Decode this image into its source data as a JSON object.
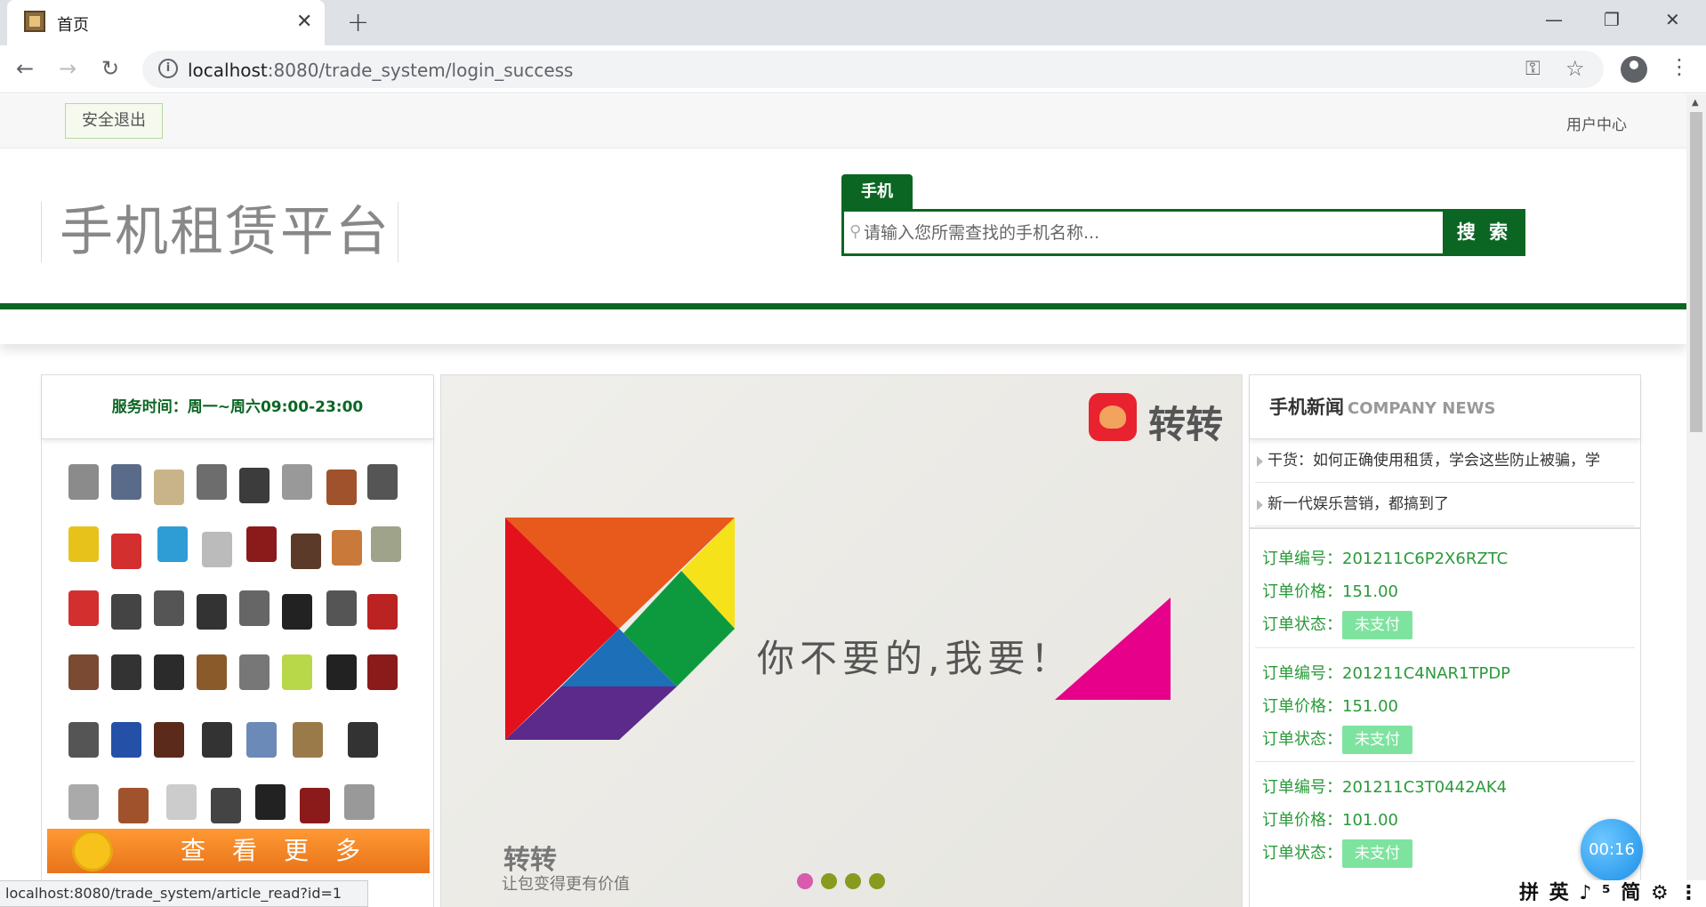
{
  "browser": {
    "tab_title": "首页",
    "url_host": "localhost",
    "url_rest": ":8080/trade_system/login_success",
    "status_url": "localhost:8080/trade_system/article_read?id=1"
  },
  "topbar": {
    "logout_label": "安全退出",
    "user_center_label": "用户中心"
  },
  "header": {
    "site_title": "手机租赁平台",
    "search_tab_label": "手机",
    "search_placeholder": "请输入您所需查找的手机名称...",
    "search_button_label": "搜 索"
  },
  "left_panel": {
    "service_hours": "服务时间：周一~周六09:00-23:00",
    "more_label": "查看更多"
  },
  "banner": {
    "logo_text": "转转",
    "slogan": "你不要的,我要！",
    "brand_text": "转转",
    "brand_sub": "让包变得更有价值",
    "slide_count": 4,
    "active_slide": 1
  },
  "news": {
    "title_zh": "手机新闻",
    "title_en": "COMPANY NEWS",
    "items": [
      {
        "text": "干货：如何正确使用租赁，学会这些防止被骗，学"
      },
      {
        "text": "新一代娱乐营销，都搞到了"
      }
    ]
  },
  "orders": {
    "number_label": "订单编号：",
    "price_label": "订单价格：",
    "status_label": "订单状态：",
    "items": [
      {
        "number": "201211C6P2X6RZTC",
        "price": "151.00",
        "status": "未支付"
      },
      {
        "number": "201211C4NAR1TPDP",
        "price": "151.00",
        "status": "未支付"
      },
      {
        "number": "201211C3T0442AK4",
        "price": "101.00",
        "status": "未支付"
      }
    ]
  },
  "overlay": {
    "timer": "00:16",
    "ime": "拼 英 ♪ ⁵ 简 ⚙ ⋮"
  },
  "colors": {
    "brand_green": "#0b6623",
    "order_green": "#2a9a3a",
    "badge_green": "#7fe3a0",
    "more_orange": "#f08a24"
  }
}
